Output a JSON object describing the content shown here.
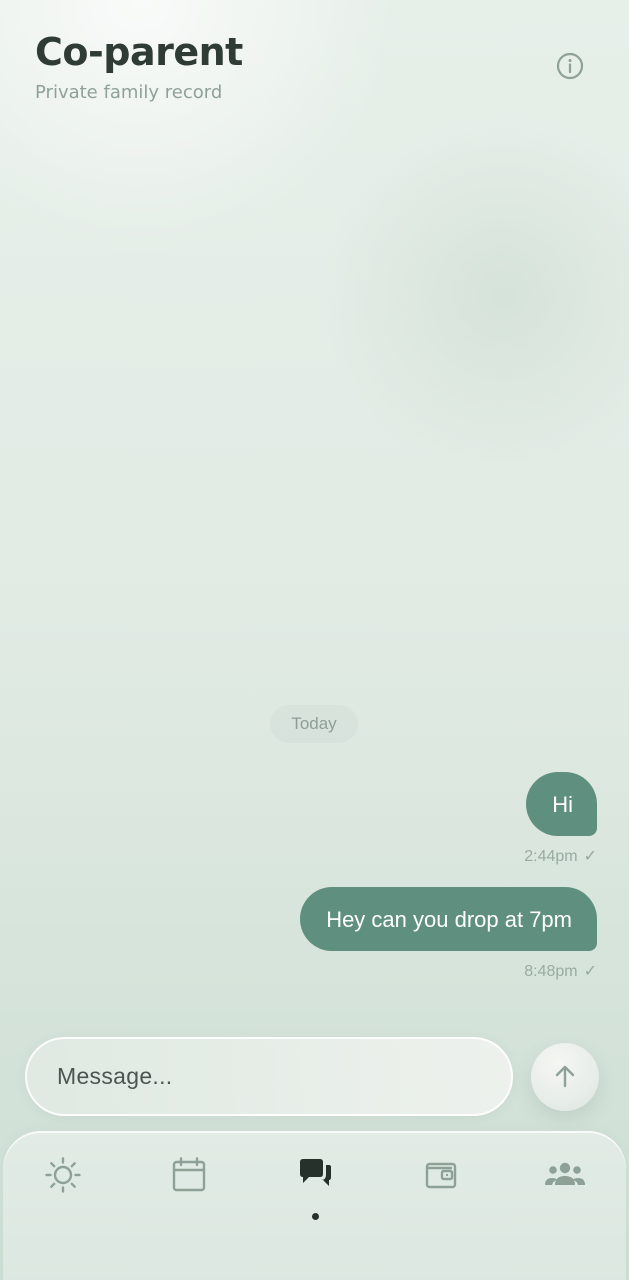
{
  "header": {
    "title": "Co-parent",
    "subtitle": "Private family record"
  },
  "chat": {
    "date_label": "Today",
    "messages": [
      {
        "text": "Hi",
        "time": "2:44pm",
        "status_icon": "check-icon"
      },
      {
        "text": "Hey can you drop at 7pm",
        "time": "8:48pm",
        "status_icon": "check-icon"
      }
    ]
  },
  "composer": {
    "placeholder": "Message...",
    "value": ""
  },
  "nav": {
    "items": [
      {
        "icon": "sun-icon"
      },
      {
        "icon": "calendar-icon"
      },
      {
        "icon": "chat-icon"
      },
      {
        "icon": "wallet-icon"
      },
      {
        "icon": "people-icon"
      }
    ]
  },
  "colors": {
    "background_top": "#e7efe9",
    "background_bottom": "#cddfd4",
    "title_text": "#2f3b35",
    "subtitle_text": "#8fa198",
    "bubble": "#5f8f7e",
    "meta_text": "#9aaba2",
    "icon_muted": "#8da196",
    "icon_active": "#26312b"
  }
}
